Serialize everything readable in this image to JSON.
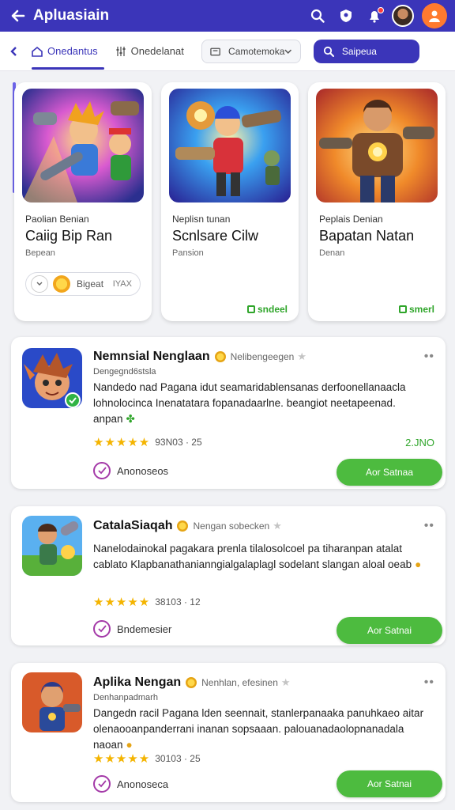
{
  "appbar": {
    "title": "Apluasiain",
    "icons": [
      "back-arrow-icon",
      "search-icon",
      "shield-icon",
      "bell-icon",
      "avatar",
      "profile-icon"
    ]
  },
  "tabs": {
    "active_label": "Onedantus",
    "second_label": "Onedelanat",
    "select_value": "Camotemoka",
    "search_label": "Saipeua"
  },
  "featured": [
    {
      "category": "Paolian Benian",
      "name": "Caiig Bip Ran",
      "sub": "Bepean",
      "pill_label": "Bigeat",
      "pill_extra": "IYAX"
    },
    {
      "category": "Neplisn tunan",
      "name": "Scnlsare Cilw",
      "sub": "Pansion",
      "stat": "sndeel"
    },
    {
      "category": "Peplais Denian",
      "name": "Bapatan Natan",
      "sub": "Denan",
      "stat": "smerl"
    }
  ],
  "items": [
    {
      "title": "Nemnsial Nenglaan",
      "tag": "Nelibengeegen",
      "developer": "Dengegnd6stsla",
      "description": "Nandedo nad Pagana idut seamaridablensanas derfoonellanaacla lohnolocinca Inenatatara fopanadaarlne. beangiot neetapeenad. anpan",
      "rating": "93N03 · 25",
      "size": "2.JNO",
      "fav": "Anonoseos",
      "button": "Aor Satnaa"
    },
    {
      "title": "CatalaSiaqah",
      "tag": "Nengan sobecken",
      "developer": "",
      "description": "Nanelodainokal pagakara prenla tilalosolcoel pa tiharanpan atalat cablato Klapbanathanianngialgalaplagl sodelant slangan aloal oeab",
      "rating": "38103 · 12",
      "size": "",
      "fav": "Bndemesier",
      "button": "Aor Satnai"
    },
    {
      "title": "Aplika Nengan",
      "tag": "Nenhlan, efesinen",
      "developer": "Denhanpadmarh",
      "description": "Dangedn racil Pagana lden seennait, stanlerpanaaka panuhkaeo aitar olenaooanpanderrani inanan sopsaaan. palouanadaolopnanadala naoan",
      "rating": "30103 · 25",
      "size": "",
      "fav": "Anonoseca",
      "button": "Aor Satnai"
    }
  ]
}
